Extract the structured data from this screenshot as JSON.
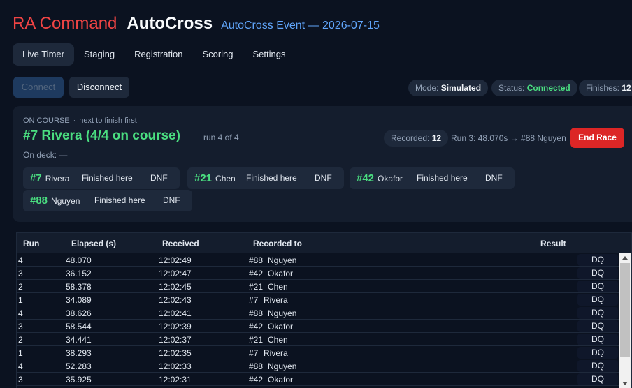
{
  "header": {
    "brand": "RA Command",
    "app": "AutoCross",
    "event": "AutoCross Event — 2026-07-15"
  },
  "tabs": [
    {
      "label": "Live Timer",
      "active": true
    },
    {
      "label": "Staging"
    },
    {
      "label": "Registration"
    },
    {
      "label": "Scoring"
    },
    {
      "label": "Settings"
    }
  ],
  "toolbar": {
    "connect_label": "Connect",
    "disconnect_label": "Disconnect",
    "mode_label": "Mode:",
    "mode_value": "Simulated",
    "status_label": "Status:",
    "status_value": "Connected",
    "finishes_label": "Finishes:",
    "finishes_value": "12"
  },
  "course": {
    "on_course_label": "ON COURSE",
    "next_label": "next to finish first",
    "current": "#7  Rivera  (4/4 on course)",
    "run_of": "run 4 of 4",
    "on_deck": "On deck:  —",
    "recorded_label": "Recorded:",
    "recorded_value": "12",
    "last_run": "Run 3: 48.070s → #88 Nguyen",
    "end_race_label": "End Race",
    "chips": [
      {
        "num": "#7",
        "name": "Rivera",
        "finished": "Finished here",
        "dnf": "DNF"
      },
      {
        "num": "#21",
        "name": "Chen",
        "finished": "Finished here",
        "dnf": "DNF"
      },
      {
        "num": "#42",
        "name": "Okafor",
        "finished": "Finished here",
        "dnf": "DNF"
      },
      {
        "num": "#88",
        "name": "Nguyen",
        "finished": "Finished here",
        "dnf": "DNF"
      }
    ]
  },
  "table": {
    "headers": [
      "Run",
      "Elapsed (s)",
      "Received",
      "Recorded to",
      "Result"
    ],
    "rows": [
      {
        "run": "4",
        "elapsed": "48.070",
        "received": "12:02:49",
        "recorded_num": "#88",
        "recorded_name": "Nguyen",
        "result": "DQ"
      },
      {
        "run": "3",
        "elapsed": "36.152",
        "received": "12:02:47",
        "recorded_num": "#42",
        "recorded_name": "Okafor",
        "result": "DQ"
      },
      {
        "run": "2",
        "elapsed": "58.378",
        "received": "12:02:45",
        "recorded_num": "#21",
        "recorded_name": "Chen",
        "result": "DQ"
      },
      {
        "run": "1",
        "elapsed": "34.089",
        "received": "12:02:43",
        "recorded_num": "#7",
        "recorded_name": "Rivera",
        "result": "DQ"
      },
      {
        "run": "4",
        "elapsed": "38.626",
        "received": "12:02:41",
        "recorded_num": "#88",
        "recorded_name": "Nguyen",
        "result": "DQ"
      },
      {
        "run": "3",
        "elapsed": "58.544",
        "received": "12:02:39",
        "recorded_num": "#42",
        "recorded_name": "Okafor",
        "result": "DQ"
      },
      {
        "run": "2",
        "elapsed": "34.441",
        "received": "12:02:37",
        "recorded_num": "#21",
        "recorded_name": "Chen",
        "result": "DQ"
      },
      {
        "run": "1",
        "elapsed": "38.293",
        "received": "12:02:35",
        "recorded_num": "#7",
        "recorded_name": "Rivera",
        "result": "DQ"
      },
      {
        "run": "4",
        "elapsed": "52.283",
        "received": "12:02:33",
        "recorded_num": "#88",
        "recorded_name": "Nguyen",
        "result": "DQ"
      },
      {
        "run": "3",
        "elapsed": "35.925",
        "received": "12:02:31",
        "recorded_num": "#42",
        "recorded_name": "Okafor",
        "result": "DQ"
      }
    ]
  }
}
